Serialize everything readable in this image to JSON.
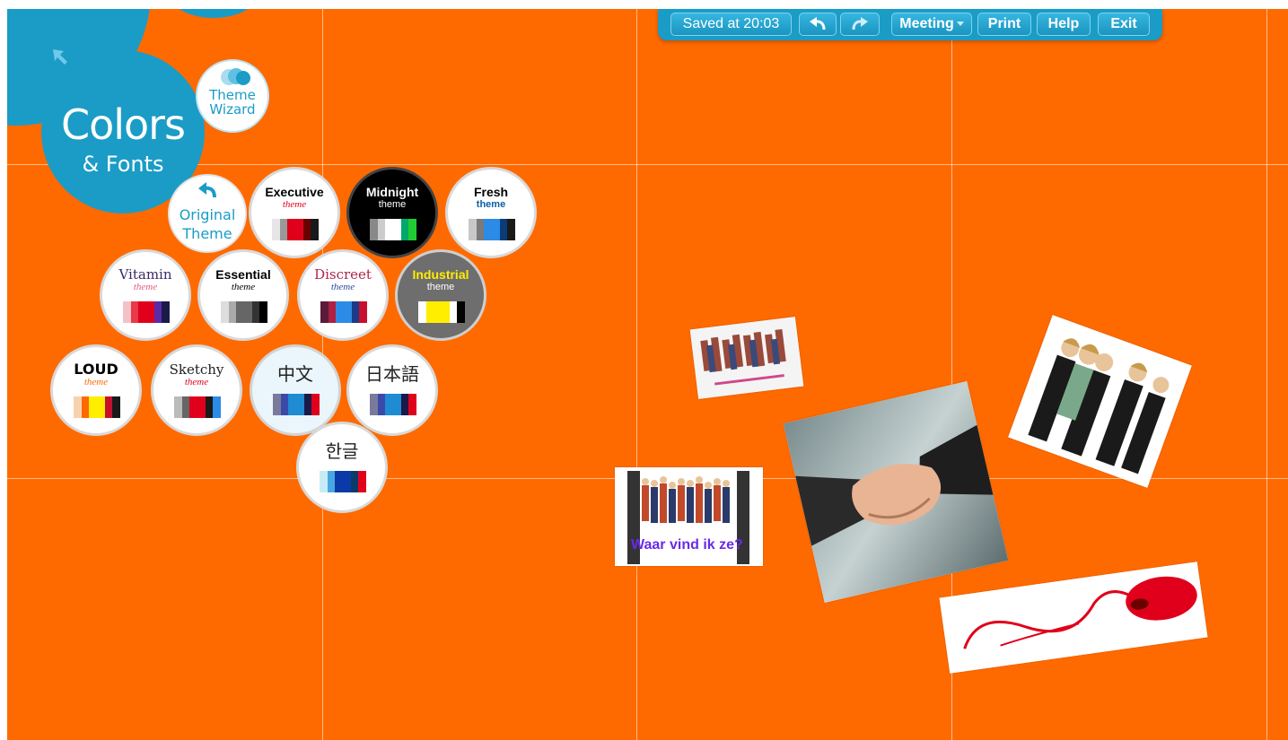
{
  "toolbar": {
    "saved": "Saved at 20:03",
    "undo_icon": "undo-arrow-icon",
    "redo_icon": "redo-arrow-icon",
    "meeting": "Meeting",
    "print": "Print",
    "help": "Help",
    "exit": "Exit"
  },
  "panel": {
    "title": "Colors",
    "subtitle": "& Fonts",
    "wizard_line1": "Theme",
    "wizard_line2": "Wizard",
    "original_line1": "Original",
    "original_line2": "Theme"
  },
  "themes": [
    {
      "name": "Executive",
      "sub": "theme",
      "name_color": "#000000",
      "sub_color": "#e0001b",
      "bg": "#ffffff",
      "swatch": [
        "#e6e6e6",
        "#999999",
        "#e0001b",
        "#e0001b",
        "#6b0000",
        "#1a1a1a"
      ]
    },
    {
      "name": "Midnight",
      "sub": "theme",
      "name_color": "#ffffff",
      "sub_color": "#ffffff",
      "bg": "#000000",
      "swatch": [
        "#888888",
        "#cccccc",
        "#ffffff",
        "#ffffff",
        "#00a86b",
        "#22cc33"
      ]
    },
    {
      "name": "Fresh",
      "sub": "theme",
      "name_color": "#000000",
      "sub_color": "#0a5fa8",
      "bg": "#ffffff",
      "swatch": [
        "#c8c8c8",
        "#7a7a7a",
        "#2b8be6",
        "#2b8be6",
        "#0a3c78",
        "#1a1a1a"
      ]
    },
    {
      "name": "Vitamin",
      "sub": "theme",
      "name_color": "#3b2a6b",
      "sub_color": "#e05a8a",
      "bg": "#ffffff",
      "swatch": [
        "#f2c2c8",
        "#e83a48",
        "#e0001b",
        "#e0001b",
        "#5a2aa8",
        "#1a1a4a"
      ]
    },
    {
      "name": "Essential",
      "sub": "theme",
      "name_color": "#000000",
      "sub_color": "#000000",
      "bg": "#ffffff",
      "swatch": [
        "#dddddd",
        "#aaaaaa",
        "#666666",
        "#666666",
        "#333333",
        "#000000"
      ]
    },
    {
      "name": "Discreet",
      "sub": "theme",
      "name_color": "#b0264a",
      "sub_color": "#2a4a9a",
      "bg": "#ffffff",
      "swatch": [
        "#5a1a3a",
        "#b02040",
        "#2b8be6",
        "#2b8be6",
        "#1a3a8a",
        "#c8102e"
      ]
    },
    {
      "name": "Industrial",
      "sub": "theme",
      "name_color": "#ffee00",
      "sub_color": "#ffffff",
      "bg": "#6e6e6e",
      "swatch": [
        "#ffffff",
        "#ffee00",
        "#ffee00",
        "#ffee00",
        "#ffffff",
        "#000000"
      ]
    },
    {
      "name": "LOUD",
      "sub": "theme",
      "name_color": "#000000",
      "sub_color": "#ff6a00",
      "bg": "#ffffff",
      "swatch": [
        "#f7d2b0",
        "#ff6a00",
        "#ffee00",
        "#ffee00",
        "#c8102e",
        "#1a1a1a"
      ]
    },
    {
      "name": "Sketchy",
      "sub": "theme",
      "name_color": "#222222",
      "sub_color": "#e0001b",
      "bg": "#ffffff",
      "swatch": [
        "#bbbbbb",
        "#666666",
        "#e0001b",
        "#e0001b",
        "#1a1a1a",
        "#2b8be6"
      ]
    },
    {
      "name": "中文",
      "sub": "",
      "name_color": "#222222",
      "sub_color": "#222222",
      "bg": "#eaf6fb",
      "swatch": [
        "#7a7a9a",
        "#3a4aaa",
        "#1e8bd2",
        "#1e8bd2",
        "#1a1a4a",
        "#e0001b"
      ]
    },
    {
      "name": "日本語",
      "sub": "",
      "name_color": "#222222",
      "sub_color": "#222222",
      "bg": "#ffffff",
      "swatch": [
        "#7a7a9a",
        "#3a4aaa",
        "#1e8bd2",
        "#1e8bd2",
        "#1a1a4a",
        "#e0001b"
      ]
    },
    {
      "name": "한글",
      "sub": "",
      "name_color": "#222222",
      "sub_color": "#222222",
      "bg": "#ffffff",
      "swatch": [
        "#c8ecf6",
        "#4aa8e0",
        "#0a3aa8",
        "#0a3aa8",
        "#0a3a6a",
        "#e0001b"
      ]
    }
  ],
  "canvas": {
    "background": "#ff6a00",
    "accent": "#1a9cc6",
    "slide_caption": "Waar vind ik ze?"
  }
}
